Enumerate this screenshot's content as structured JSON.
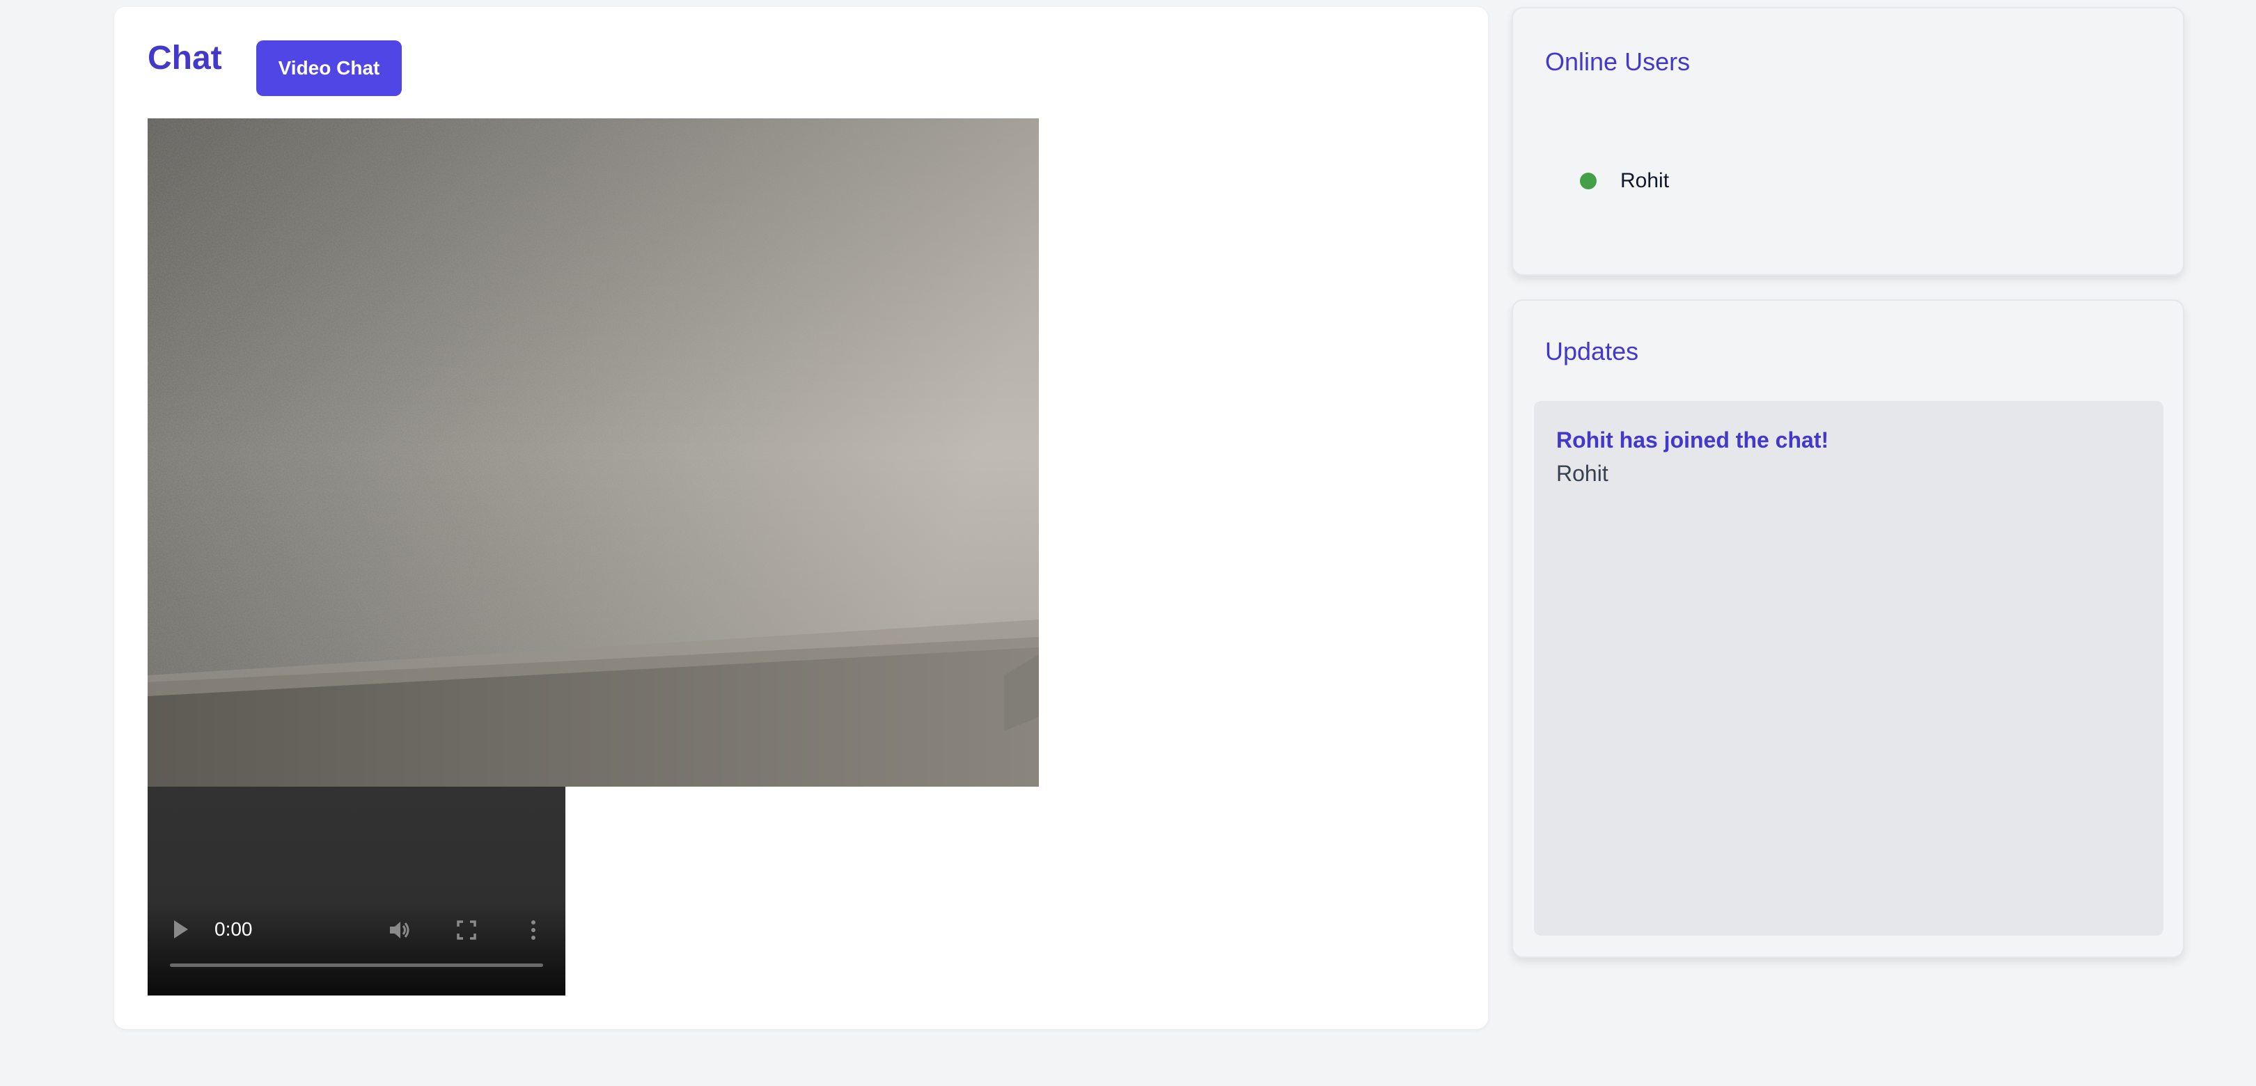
{
  "chat": {
    "title": "Chat",
    "video_chat_label": "Video Chat",
    "video_player": {
      "time": "0:00"
    }
  },
  "online_users": {
    "title": "Online Users",
    "users": [
      {
        "name": "Rohit",
        "status": "online",
        "status_color": "#43a047"
      }
    ]
  },
  "updates": {
    "title": "Updates",
    "items": [
      {
        "title": "Rohit has joined the chat!",
        "body": "Rohit"
      }
    ]
  },
  "colors": {
    "accent": "#4338ca",
    "button": "#4f46e5",
    "background": "#f3f4f6"
  },
  "icons": [
    "play-icon",
    "volume-icon",
    "fullscreen-icon",
    "more-options-icon",
    "status-dot-icon"
  ]
}
